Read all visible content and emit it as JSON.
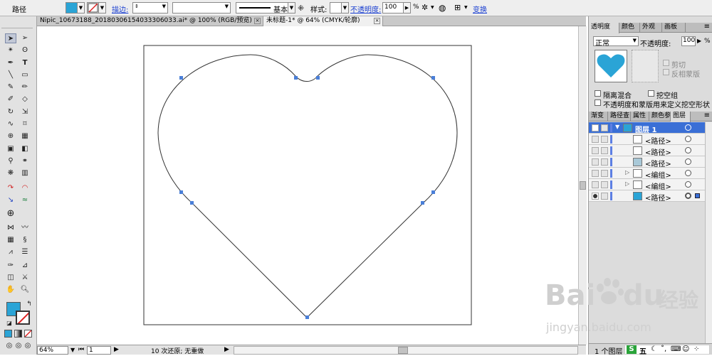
{
  "control_bar": {
    "object_type": "路径",
    "stroke_label": "描边:",
    "stroke_profile": "基本",
    "style_label": "样式:",
    "opacity_label": "不透明度:",
    "opacity_value": "100",
    "opacity_unit": "%",
    "transform_label": "变换",
    "fill_color": "#2aa4d6"
  },
  "document_tabs": [
    {
      "label": "Nipic_10673188_20180306154033306033.ai* @ 100% (RGB/预览)",
      "active": false
    },
    {
      "label": "未标题-1* @ 64% (CMYK/轮廓)",
      "active": true
    }
  ],
  "status_bar": {
    "zoom": "64%",
    "artboard": "1",
    "undo_info": "10 次还原; 无重做"
  },
  "transparency_panel": {
    "tabs": [
      "透明度",
      "颜色",
      "外观",
      "画板"
    ],
    "blend_mode": "正常",
    "opacity_label": "不透明度:",
    "opacity_value": "100",
    "opacity_unit": "%",
    "clip_label": "剪切",
    "invert_mask_label": "反相蒙版",
    "isolate_blending_label": "隔离混合",
    "knockout_group_label": "挖空组",
    "opacity_mask_label": "不透明度和蒙版用来定义挖空形状"
  },
  "layers_panel": {
    "tabs": [
      "渐变",
      "路径查",
      "属性",
      "颜色参",
      "图层"
    ],
    "rows": [
      {
        "name": "图层 1",
        "selected": true
      },
      {
        "name": "<路径>",
        "selected": false
      },
      {
        "name": "<路径>",
        "selected": false
      },
      {
        "name": "<路径>",
        "selected": false
      },
      {
        "name": "<编组>",
        "selected": false
      },
      {
        "name": "<编组>",
        "selected": false
      },
      {
        "name": "<路径>",
        "selected": false
      }
    ],
    "footer": "1 个图层"
  },
  "watermark": {
    "brand": "Bai",
    "brand2": "du",
    "product": "经验",
    "url": "jingyan.baidu.com"
  },
  "ime_bar": {
    "label": "S",
    "mode": "五"
  }
}
